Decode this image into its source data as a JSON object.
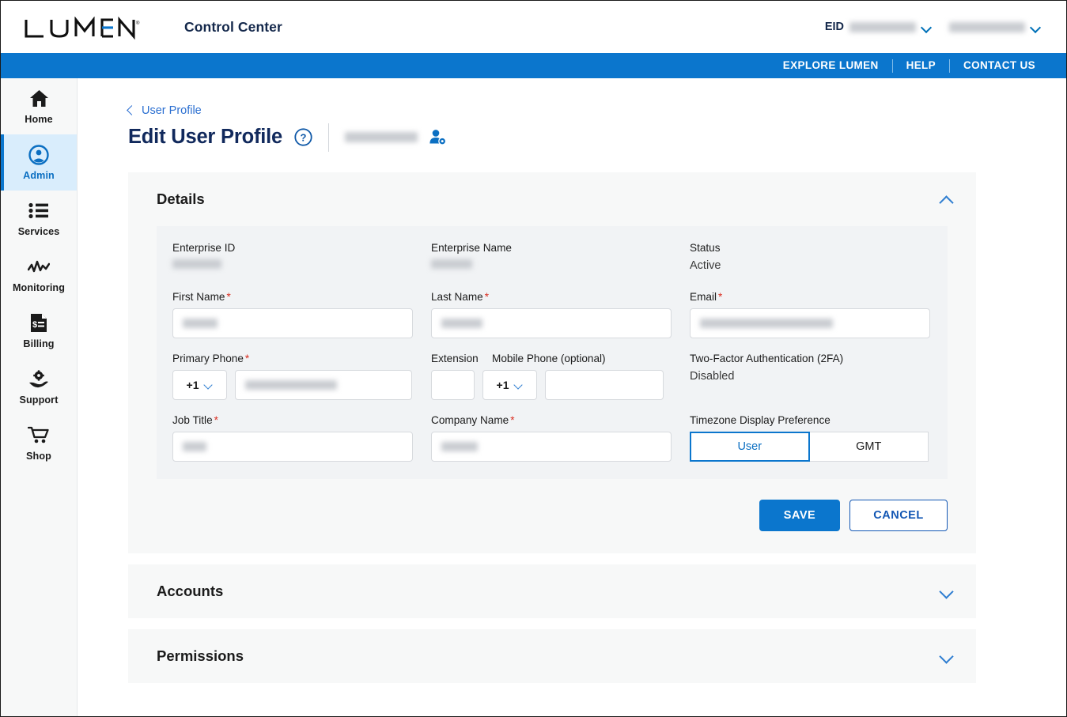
{
  "header": {
    "logo_text": "LUMEN",
    "logo_registered": "®",
    "app_title": "Control Center",
    "eid_label": "EID",
    "eid_value": "",
    "username": "",
    "eid_caret_icon": "chevron-down-icon",
    "user_caret_icon": "chevron-down-icon"
  },
  "utility_nav": {
    "items": [
      {
        "label": "EXPLORE LUMEN"
      },
      {
        "label": "HELP"
      },
      {
        "label": "CONTACT US"
      }
    ]
  },
  "sidebar": {
    "items": [
      {
        "label": "Home",
        "icon": "home-icon",
        "active": false
      },
      {
        "label": "Admin",
        "icon": "user-circle-icon",
        "active": true
      },
      {
        "label": "Services",
        "icon": "list-icon",
        "active": false
      },
      {
        "label": "Monitoring",
        "icon": "activity-icon",
        "active": false
      },
      {
        "label": "Billing",
        "icon": "invoice-icon",
        "active": false
      },
      {
        "label": "Support",
        "icon": "support-hand-icon",
        "active": false
      },
      {
        "label": "Shop",
        "icon": "cart-icon",
        "active": false
      }
    ]
  },
  "page": {
    "breadcrumb": "User Profile",
    "breadcrumb_icon": "chevron-left-icon",
    "title": "Edit User Profile",
    "help_icon": "help-circle-icon",
    "profile_username": "",
    "user_settings_icon": "user-gear-icon"
  },
  "sections": {
    "details": {
      "title": "Details",
      "expanded": true,
      "chevron_icon": "chevron-up-icon"
    },
    "accounts": {
      "title": "Accounts",
      "expanded": false,
      "chevron_icon": "chevron-down-icon"
    },
    "permissions": {
      "title": "Permissions",
      "expanded": false,
      "chevron_icon": "chevron-down-icon"
    }
  },
  "form": {
    "enterprise_id": {
      "label": "Enterprise ID",
      "value": ""
    },
    "enterprise_name": {
      "label": "Enterprise Name",
      "value": ""
    },
    "status": {
      "label": "Status",
      "value": "Active"
    },
    "first_name": {
      "label": "First Name",
      "required": "*",
      "value": ""
    },
    "last_name": {
      "label": "Last Name",
      "required": "*",
      "value": ""
    },
    "email": {
      "label": "Email",
      "required": "*",
      "value": ""
    },
    "primary_phone": {
      "label": "Primary Phone",
      "required": "*",
      "country_code": "+1",
      "value": ""
    },
    "extension": {
      "label": "Extension",
      "value": ""
    },
    "mobile_phone": {
      "label": "Mobile Phone (optional)",
      "country_code": "+1",
      "value": ""
    },
    "two_factor": {
      "label": "Two-Factor Authentication (2FA)",
      "value": "Disabled"
    },
    "job_title": {
      "label": "Job Title",
      "required": "*",
      "value": ""
    },
    "company_name": {
      "label": "Company Name",
      "required": "*",
      "value": ""
    },
    "timezone": {
      "label": "Timezone Display Preference",
      "options": [
        {
          "label": "User",
          "selected": true
        },
        {
          "label": "GMT",
          "selected": false
        }
      ]
    }
  },
  "actions": {
    "save_label": "SAVE",
    "cancel_label": "CANCEL"
  },
  "colors": {
    "brand_blue": "#0b76cd",
    "nav_active_bg": "#d9edfc",
    "title_navy": "#11295c",
    "required_red": "#d92d20",
    "card_bg": "#f7f8f8",
    "panel_bg": "#f1f3f5"
  }
}
